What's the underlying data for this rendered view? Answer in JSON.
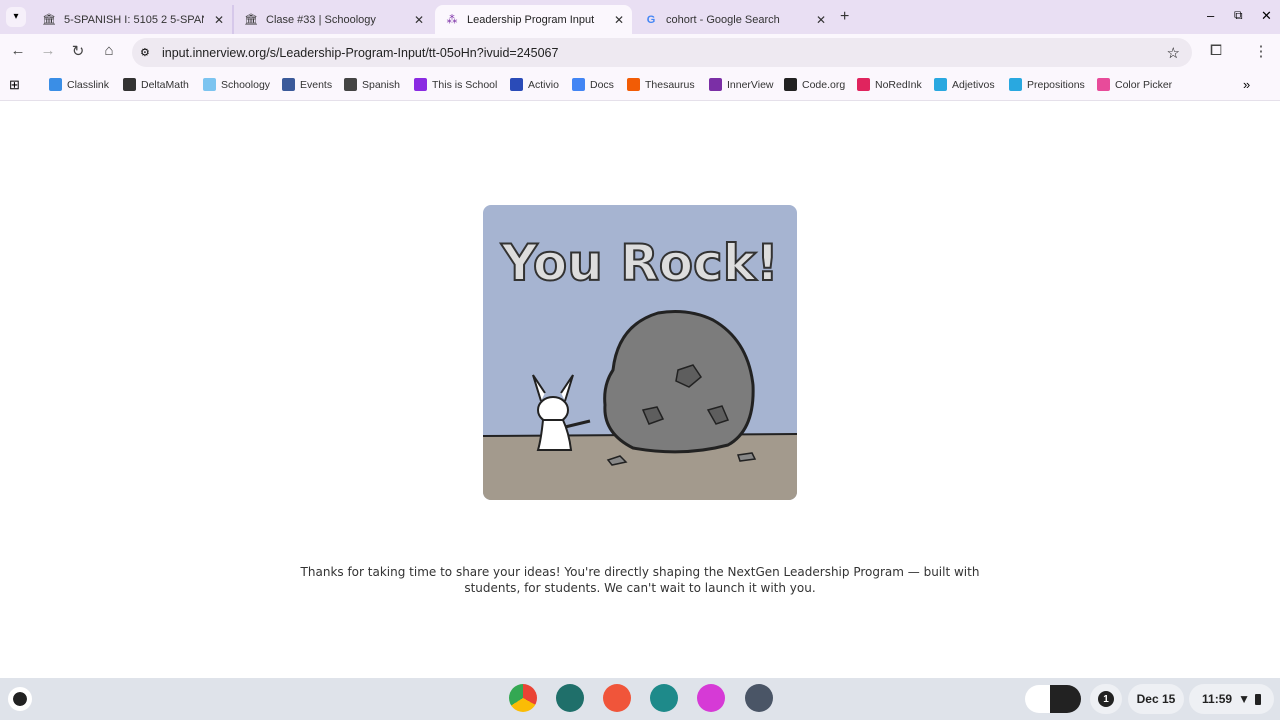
{
  "tabs": [
    {
      "title": "5-SPANISH I: 5105 2 5-SPANISH",
      "favicon": "schoology-icon"
    },
    {
      "title": "Clase #33 | Schoology",
      "favicon": "schoology-icon"
    },
    {
      "title": "Leadership Program Input",
      "favicon": "innerview-icon",
      "active": true
    },
    {
      "title": "cohort - Google Search",
      "favicon": "google-icon"
    }
  ],
  "url": "input.innerview.org/s/Leadership-Program-Input/tt-05oHn?ivuid=245067",
  "bookmarks": [
    {
      "label": "Classlink",
      "color": "#3a8ee6"
    },
    {
      "label": "DeltaMath",
      "color": "#333333"
    },
    {
      "label": "Schoology",
      "color": "#7cc4f0"
    },
    {
      "label": "Events",
      "color": "#3b5a9a"
    },
    {
      "label": "Spanish",
      "color": "#444444"
    },
    {
      "label": "This is School",
      "color": "#8a2be2"
    },
    {
      "label": "Activio",
      "color": "#2a4bb8"
    },
    {
      "label": "Docs",
      "color": "#4285f4"
    },
    {
      "label": "Thesaurus",
      "color": "#f25c05"
    },
    {
      "label": "InnerView",
      "color": "#7b2fa6"
    },
    {
      "label": "Code.org",
      "color": "#222222"
    },
    {
      "label": "NoRedInk",
      "color": "#e0245e"
    },
    {
      "label": "Adjetivos",
      "color": "#29a8e0"
    },
    {
      "label": "Prepositions",
      "color": "#29a8e0"
    },
    {
      "label": "Color Picker",
      "color": "#e84b9a"
    }
  ],
  "illustration": {
    "caption": "You Rock!"
  },
  "message": {
    "line1": "Thanks for taking  time to share your ideas! You're directly shaping the NextGen Leadership Program — built with",
    "line2": "students, for students. We can't wait to launch it with you."
  },
  "shelf": {
    "notifications": "1",
    "date": "Dec 15",
    "time": "11:59"
  }
}
